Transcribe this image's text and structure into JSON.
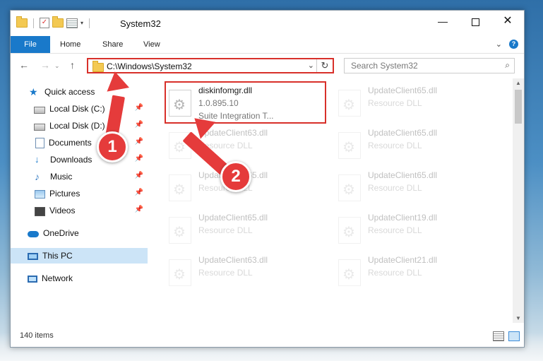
{
  "window": {
    "title": "System32"
  },
  "window_controls": {
    "minimize": "—",
    "close": "✕"
  },
  "ribbon": {
    "tabs": [
      "File",
      "Home",
      "Share",
      "View"
    ],
    "expand": "⌄",
    "help": "?"
  },
  "address": {
    "path": "C:\\Windows\\System32",
    "dropdown": "⌄",
    "refresh": "↻"
  },
  "nav_buttons": {
    "back": "←",
    "forward": "→",
    "history": "⌄",
    "up": "↑"
  },
  "search": {
    "placeholder": "Search System32",
    "icon": "⌕"
  },
  "nav_pane": {
    "items": [
      {
        "label": "Quick access",
        "icon": "star-icon"
      },
      {
        "label": "Local Disk (C:)",
        "icon": "disk-icon",
        "pinned": true
      },
      {
        "label": "Local Disk (D:)",
        "icon": "disk-icon",
        "pinned": true
      },
      {
        "label": "Documents",
        "icon": "document-icon",
        "pinned": true
      },
      {
        "label": "Downloads",
        "icon": "download-icon",
        "pinned": true
      },
      {
        "label": "Music",
        "icon": "music-icon",
        "pinned": true
      },
      {
        "label": "Pictures",
        "icon": "pictures-icon",
        "pinned": true
      },
      {
        "label": "Videos",
        "icon": "video-icon",
        "pinned": true
      },
      {
        "label": "OneDrive",
        "icon": "cloud-icon"
      },
      {
        "label": "This PC",
        "icon": "computer-icon",
        "selected": true
      },
      {
        "label": "Network",
        "icon": "network-icon"
      }
    ],
    "pin_glyph": "📌"
  },
  "files": [
    {
      "name": "diskinfomgr.dll",
      "line1": "1.0.895.10",
      "line2": "Suite Integration T...",
      "highlighted": true
    },
    {
      "name": "UpdateClient65.dll",
      "line1": "Resource DLL"
    },
    {
      "name": "UpdateClient63.dll",
      "line1": "Resource DLL"
    },
    {
      "name": "UpdateClient65.dll",
      "line1": "Resource DLL"
    },
    {
      "name": "UpdateClient65.dll",
      "line1": "Resource DLL"
    },
    {
      "name": "UpdateClient65.dll",
      "line1": "Resource DLL"
    },
    {
      "name": "UpdateClient65.dll",
      "line1": "Resource DLL"
    },
    {
      "name": "UpdateClient19.dll",
      "line1": "Resource DLL"
    },
    {
      "name": "UpdateClient63.dll",
      "line1": "Resource DLL"
    },
    {
      "name": "UpdateClient21.dll",
      "line1": "Resource DLL"
    }
  ],
  "status": {
    "items_count": "140 items"
  },
  "annotations": [
    {
      "number": "1"
    },
    {
      "number": "2"
    }
  ],
  "colors": {
    "accent": "#1979ca",
    "highlight": "#d8302a",
    "annotation": "#e53b3b",
    "selection": "#cce4f7"
  }
}
